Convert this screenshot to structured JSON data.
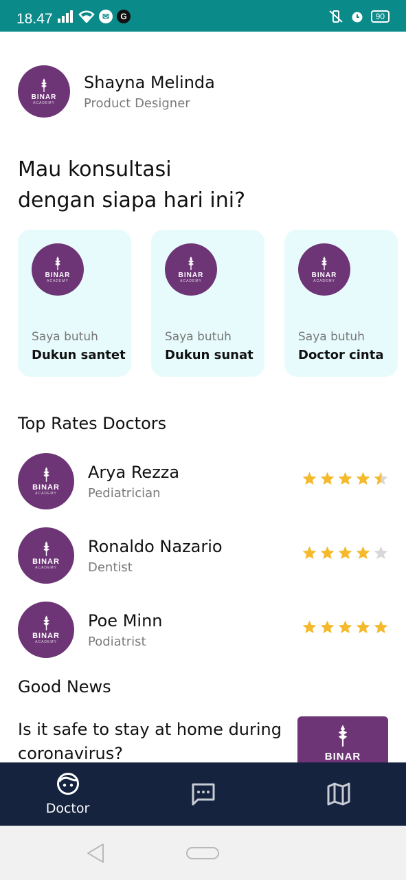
{
  "status_bar": {
    "time": "18.47",
    "battery": "90",
    "icons_left": [
      "signal-icon",
      "wifi-icon",
      "outlook-icon",
      "google-icon"
    ],
    "icons_right": [
      "vibrate-icon",
      "alarm-icon",
      "battery-icon"
    ]
  },
  "profile": {
    "name": "Shayna Melinda",
    "role": "Product Designer"
  },
  "logo": {
    "text": "BINAR",
    "sub": "ACADEMY"
  },
  "headline": {
    "line1": "Mau konsultasi",
    "line2": "dengan siapa hari ini?"
  },
  "categories": [
    {
      "prefix": "Saya butuh",
      "title": "Dukun santet"
    },
    {
      "prefix": "Saya butuh",
      "title": "Dukun sunat"
    },
    {
      "prefix": "Saya butuh",
      "title": "Doctor cinta"
    }
  ],
  "top_doctors": {
    "title": "Top Rates Doctors",
    "items": [
      {
        "name": "Arya Rezza",
        "specialty": "Pediatrician",
        "rating": 4.5
      },
      {
        "name": "Ronaldo Nazario",
        "specialty": "Dentist",
        "rating": 4
      },
      {
        "name": "Poe Minn",
        "specialty": "Podiatrist",
        "rating": 5
      }
    ]
  },
  "news": {
    "title": "Good News",
    "headline": "Is it safe to stay at home during coronavirus?"
  },
  "bottom_nav": {
    "items": [
      {
        "label": "Doctor",
        "icon": "doctor-face-icon",
        "active": true
      },
      {
        "label": "",
        "icon": "chat-icon",
        "active": false
      },
      {
        "label": "",
        "icon": "map-icon",
        "active": false
      }
    ]
  },
  "colors": {
    "status_bar": "#0b8a8a",
    "brand_purple": "#6d3476",
    "card_bg": "#e8fbfc",
    "nav_bg": "#15233f",
    "star_filled": "#f4b92c",
    "star_empty": "#d8d8d8"
  }
}
